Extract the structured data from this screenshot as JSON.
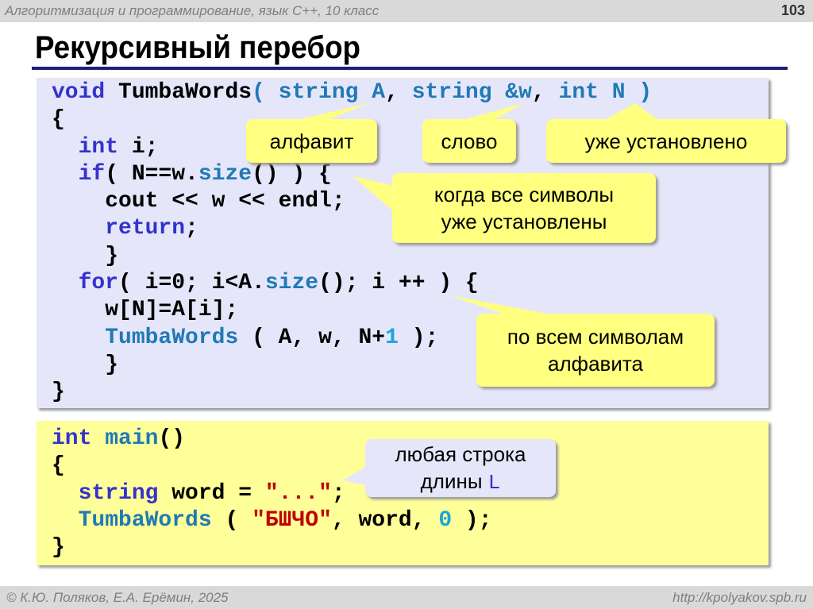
{
  "header": {
    "course": "Алгоритмизация и программирование, язык С++, 10 класс",
    "page_number": "103"
  },
  "title": "Рекурсивный перебор",
  "code_function": [
    [
      [
        "kw",
        "void "
      ],
      [
        "pl",
        "TumbaWords"
      ],
      [
        "ty",
        "( string A"
      ],
      [
        "pl",
        ", "
      ],
      [
        "ty",
        "string &w"
      ],
      [
        "pl",
        ", "
      ],
      [
        "ty",
        "int N )"
      ]
    ],
    [
      [
        "pl",
        "{"
      ]
    ],
    [
      [
        "pl",
        "  "
      ],
      [
        "kw",
        "int"
      ],
      [
        "pl",
        " i;"
      ]
    ],
    [
      [
        "pl",
        "  "
      ],
      [
        "kw",
        "if"
      ],
      [
        "pl",
        "( N==w."
      ],
      [
        "fn",
        "size"
      ],
      [
        "pl",
        "() ) {"
      ]
    ],
    [
      [
        "pl",
        "    cout << w << endl;"
      ]
    ],
    [
      [
        "pl",
        "    "
      ],
      [
        "kw",
        "return"
      ],
      [
        "pl",
        ";"
      ]
    ],
    [
      [
        "pl",
        "    }"
      ]
    ],
    [
      [
        "pl",
        "  "
      ],
      [
        "kw",
        "for"
      ],
      [
        "pl",
        "( i=0; i<A."
      ],
      [
        "fn",
        "size"
      ],
      [
        "pl",
        "(); i ++ ) {"
      ]
    ],
    [
      [
        "pl",
        "    w[N]=A[i];"
      ]
    ],
    [
      [
        "pl",
        "    "
      ],
      [
        "fn",
        "TumbaWords"
      ],
      [
        "pl",
        " ( A, w, N+"
      ],
      [
        "num",
        "1"
      ],
      [
        "pl",
        " );"
      ]
    ],
    [
      [
        "pl",
        "    }"
      ]
    ],
    [
      [
        "pl",
        "}"
      ]
    ]
  ],
  "code_main": [
    [
      [
        "kw",
        "int "
      ],
      [
        "fn",
        "main"
      ],
      [
        "pl",
        "()"
      ]
    ],
    [
      [
        "pl",
        "{"
      ]
    ],
    [
      [
        "pl",
        "  "
      ],
      [
        "kw",
        "string"
      ],
      [
        "pl",
        " word = "
      ],
      [
        "str",
        "\"...\""
      ],
      [
        "pl",
        ";"
      ]
    ],
    [
      [
        "pl",
        "  "
      ],
      [
        "fn",
        "TumbaWords"
      ],
      [
        "pl",
        " ( "
      ],
      [
        "str",
        "\"БШЧО\""
      ],
      [
        "pl",
        ", word, "
      ],
      [
        "num",
        "0"
      ],
      [
        "pl",
        " );"
      ]
    ],
    [
      [
        "pl",
        "}"
      ]
    ]
  ],
  "callouts": {
    "alphabet": "алфавит",
    "word": "слово",
    "already_set": "уже установлено",
    "all_set_1": "когда все символы",
    "all_set_2": "уже установлены",
    "all_symbols_1": "по всем символам",
    "all_symbols_2": "алфавита",
    "any_string_1": "любая строка",
    "any_string_2": "длины ",
    "any_string_var": "L"
  },
  "footer": {
    "authors": "© К.Ю. Поляков, Е.А. Ерёмин, 2025",
    "site": "http://kpolyakov.spb.ru"
  }
}
